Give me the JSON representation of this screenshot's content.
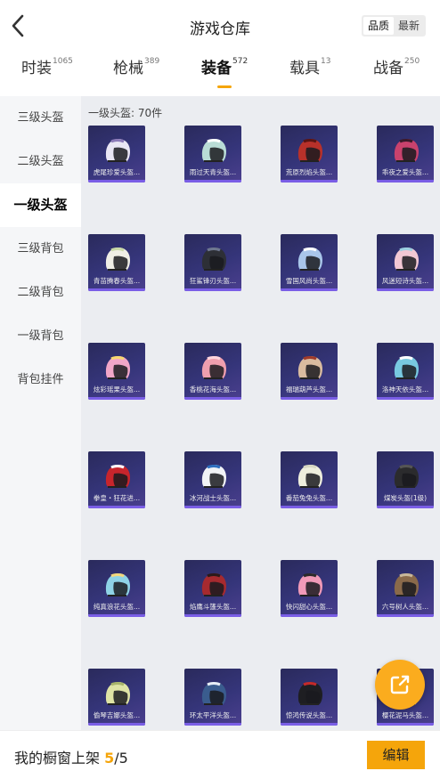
{
  "header": {
    "title": "游戏仓库",
    "sort_options": [
      {
        "label": "品质",
        "active": true
      },
      {
        "label": "最新",
        "active": false
      }
    ]
  },
  "tabs": [
    {
      "label": "时装",
      "count": "1065",
      "active": false
    },
    {
      "label": "枪械",
      "count": "389",
      "active": false
    },
    {
      "label": "装备",
      "count": "572",
      "active": true
    },
    {
      "label": "载具",
      "count": "13",
      "active": false
    },
    {
      "label": "战备",
      "count": "250",
      "active": false
    }
  ],
  "sidebar": {
    "items": [
      {
        "label": "三级头盔",
        "active": false
      },
      {
        "label": "二级头盔",
        "active": false
      },
      {
        "label": "一级头盔",
        "active": true
      },
      {
        "label": "三级背包",
        "active": false
      },
      {
        "label": "二级背包",
        "active": false
      },
      {
        "label": "一级背包",
        "active": false
      },
      {
        "label": "背包挂件",
        "active": false
      }
    ]
  },
  "content": {
    "section_label": "一级头盔: 70件",
    "items": [
      {
        "name": "虎尾珍爱头盔...",
        "color": "#e9e6f4",
        "accent": "#8b7ab8",
        "icon": "helmet-icon"
      },
      {
        "name": "雨过天青头盔...",
        "color": "#b9dcd6",
        "accent": "#ffffff",
        "icon": "helmet-icon"
      },
      {
        "name": "荒原烈焰头盔...",
        "color": "#b8312a",
        "accent": "#5a1412",
        "icon": "helmet-icon"
      },
      {
        "name": "乖夜之爱头盔...",
        "color": "#c9426d",
        "accent": "#3a1a2a",
        "icon": "helmet-icon"
      },
      {
        "name": "青苗腾春头盔...",
        "color": "#efeee5",
        "accent": "#c9d9a6",
        "icon": "helmet-icon"
      },
      {
        "name": "狂鲨锋刃头盔...",
        "color": "#2d2f36",
        "accent": "#6f7890",
        "icon": "helmet-icon"
      },
      {
        "name": "雪国风尚头盔...",
        "color": "#a9c6ea",
        "accent": "#ffffff",
        "icon": "helmet-icon"
      },
      {
        "name": "风迷短诗头盔...",
        "color": "#f2c8d4",
        "accent": "#9ccfe0",
        "icon": "helmet-icon"
      },
      {
        "name": "炫彩瑶果头盔...",
        "color": "#f2a6c8",
        "accent": "#f7d770",
        "icon": "helmet-icon"
      },
      {
        "name": "香桃花海头盔...",
        "color": "#ef9fae",
        "accent": "#ffd6de",
        "icon": "helmet-icon"
      },
      {
        "name": "福瑞葫芦头盔...",
        "color": "#d9bba0",
        "accent": "#a03a2a",
        "icon": "helmet-icon"
      },
      {
        "name": "洛神天依头盔...",
        "color": "#78c9e0",
        "accent": "#ffffff",
        "icon": "helmet-icon"
      },
      {
        "name": "拳皇・狂花进...",
        "color": "#c8252c",
        "accent": "#ffffff",
        "icon": "helmet-icon"
      },
      {
        "name": "冰河战士头盔...",
        "color": "#f1f3f6",
        "accent": "#2e6fbf",
        "icon": "helmet-icon"
      },
      {
        "name": "番茄兔兔头盔...",
        "color": "#eeeedd",
        "accent": "#d7d7c2",
        "icon": "helmet-icon"
      },
      {
        "name": "煤炭头盔(1级)",
        "color": "#2b2b2d",
        "accent": "#555555",
        "icon": "helmet-icon"
      },
      {
        "name": "纯真浪花头盔...",
        "color": "#8fd3e6",
        "accent": "#f3d77c",
        "icon": "helmet-icon"
      },
      {
        "name": "焰鹰斗篷头盔...",
        "color": "#a62a2f",
        "accent": "#2a1a1a",
        "icon": "helmet-icon"
      },
      {
        "name": "快闪甜心头盔...",
        "color": "#f19ab8",
        "accent": "#2a2a2a",
        "icon": "helmet-icon"
      },
      {
        "name": "六号树人头盔...",
        "color": "#8a6a4a",
        "accent": "#c9b89a",
        "icon": "helmet-icon"
      },
      {
        "name": "偷琴吉娜头盔...",
        "color": "#dfe4a5",
        "accent": "#a8b46a",
        "icon": "helmet-icon"
      },
      {
        "name": "环太平洋头盔...",
        "color": "#3a5c8e",
        "accent": "#e8eef6",
        "icon": "helmet-icon"
      },
      {
        "name": "惊鸿传说头盔...",
        "color": "#1e1e22",
        "accent": "#c42a2a",
        "icon": "helmet-icon"
      },
      {
        "name": "樱花泥马头盔...",
        "color": "#f0d3d8",
        "accent": "#b07a8a",
        "icon": "helmet-icon"
      }
    ]
  },
  "footer": {
    "showcase_label": "我的橱窗上架",
    "showcase_current": "5",
    "showcase_sep_total": "/5",
    "edit_label": "编辑"
  },
  "colors": {
    "accent": "#f5a50b",
    "card_bg": "#35357a",
    "card_bar": "#7a5ee6",
    "share_button": "#fbac1e"
  }
}
